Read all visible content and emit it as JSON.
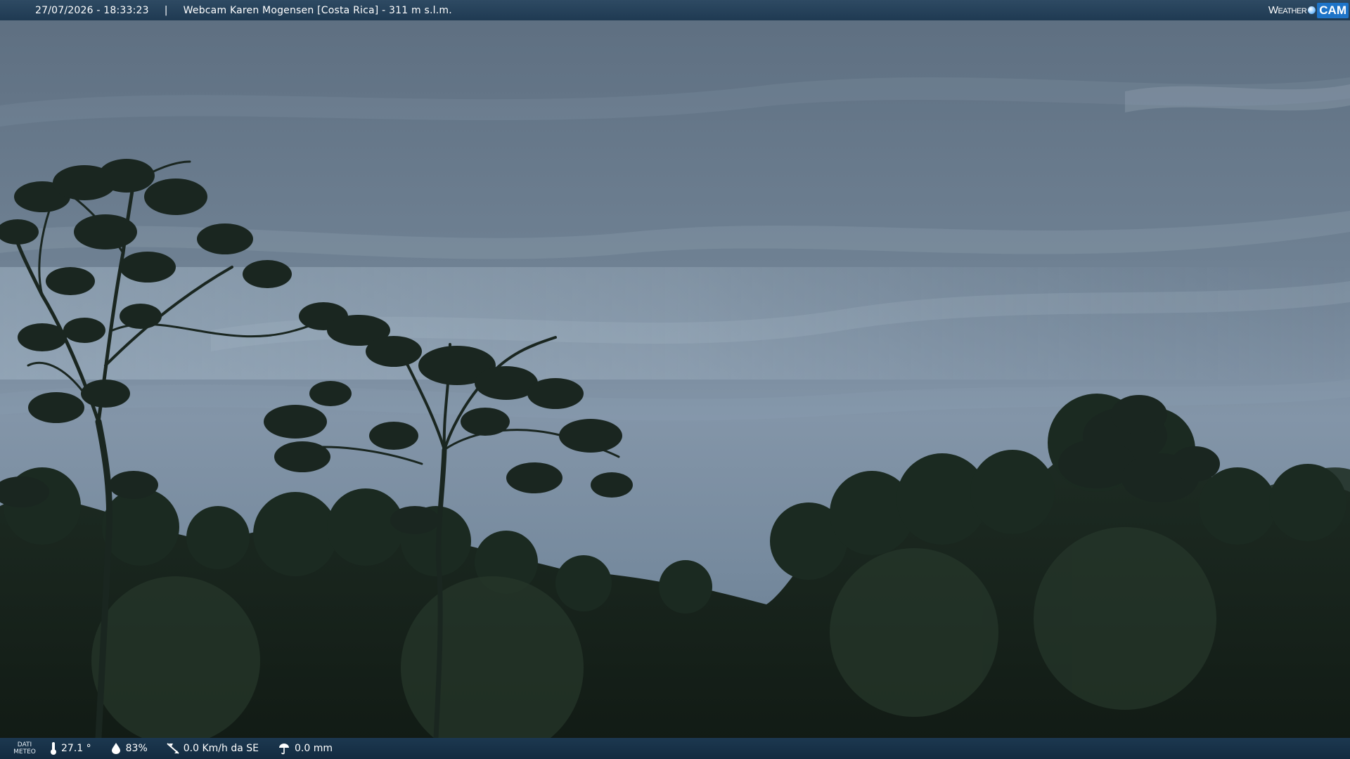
{
  "header": {
    "datetime": "27/07/2026 - 18:33:23",
    "separator": "|",
    "title": "Webcam Karen Mogensen [Costa Rica]  - 311 m s.l.m."
  },
  "brand": {
    "weather": "Weather",
    "cam": "CAM"
  },
  "footer": {
    "dati_line1": "DATI",
    "dati_line2": "METEO",
    "temperature": "27.1 °",
    "humidity": "83%",
    "wind": "0.0 Km/h da SE",
    "rain": "0.0 mm"
  },
  "scene": {
    "sky_top": "#6b7c8d",
    "sky_mid": "#8a9cad",
    "sky_low": "#7f93a6",
    "foliage": "#1c2a22",
    "foliage_dark": "#111b15"
  }
}
